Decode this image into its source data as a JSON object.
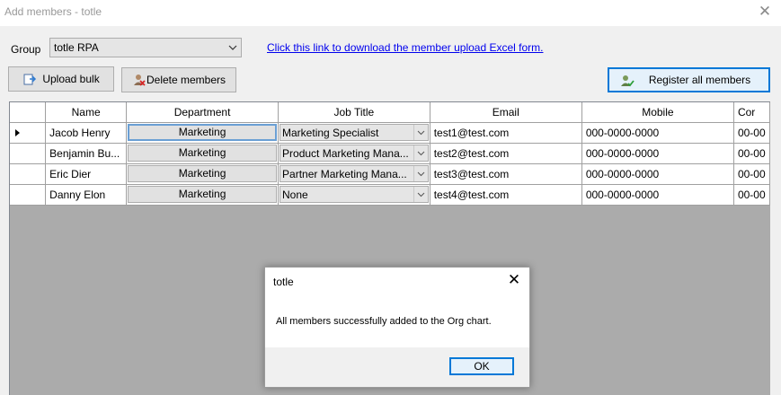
{
  "window": {
    "title": "Add members - totle",
    "close_glyph": "✕"
  },
  "group": {
    "label": "Group",
    "selected": "totle RPA"
  },
  "download_link": "Click this link to download the member upload Excel form.",
  "buttons": {
    "upload": "Upload bulk",
    "delete": "Delete members",
    "register": "Register all members"
  },
  "grid": {
    "columns": [
      "Name",
      "Department",
      "Job Title",
      "Email",
      "Mobile",
      "Cor"
    ],
    "rows": [
      {
        "name": "Jacob Henry",
        "department": "Marketing",
        "job_title": "Marketing Specialist",
        "email": "test1@test.com",
        "mobile": "000-0000-0000",
        "extra": "00-00"
      },
      {
        "name": "Benjamin Bu...",
        "department": "Marketing",
        "job_title": "Product Marketing Mana...",
        "email": "test2@test.com",
        "mobile": "000-0000-0000",
        "extra": "00-00"
      },
      {
        "name": "Eric Dier",
        "department": "Marketing",
        "job_title": "Partner Marketing Mana...",
        "email": "test3@test.com",
        "mobile": "000-0000-0000",
        "extra": "00-00"
      },
      {
        "name": "Danny Elon",
        "department": "Marketing",
        "job_title": "None",
        "email": "test4@test.com",
        "mobile": "000-0000-0000",
        "extra": "00-00"
      }
    ]
  },
  "dialog": {
    "title": "totle",
    "close_glyph": "✕",
    "message": "All members successfully added to the Org chart.",
    "ok": "OK"
  },
  "colors": {
    "accent": "#0078d7",
    "grid_bg": "#ababab",
    "link": "#0000ee"
  }
}
